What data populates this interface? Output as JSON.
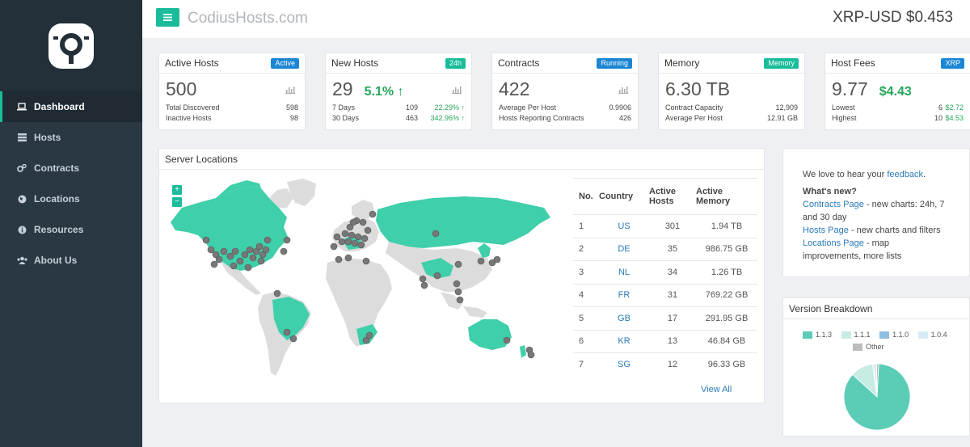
{
  "header": {
    "site_title": "CodiusHosts.com",
    "ticker": "XRP-USD $0.453"
  },
  "sidebar": {
    "items": [
      {
        "label": "Dashboard",
        "icon": "laptop-icon"
      },
      {
        "label": "Hosts",
        "icon": "server-icon"
      },
      {
        "label": "Contracts",
        "icon": "cogs-icon"
      },
      {
        "label": "Locations",
        "icon": "globe-icon"
      },
      {
        "label": "Resources",
        "icon": "info-icon"
      },
      {
        "label": "About Us",
        "icon": "users-icon"
      }
    ]
  },
  "stats": {
    "active": {
      "title": "Active Hosts",
      "badge": "Active",
      "big": "500",
      "r1k": "Total Discovered",
      "r1v": "598",
      "r2k": "Inactive Hosts",
      "r2v": "98"
    },
    "new": {
      "title": "New Hosts",
      "badge": "24h",
      "big": "29",
      "big_extra": "5.1%",
      "r1k": "7 Days",
      "r1v": "109",
      "r1g": "22.29%",
      "r2k": "30 Days",
      "r2v": "463",
      "r2g": "342.96%"
    },
    "contracts": {
      "title": "Contracts",
      "badge": "Running",
      "big": "422",
      "r1k": "Average Per Host",
      "r1v": "0.9906",
      "r2k": "Hosts Reporting Contracts",
      "r2v": "426"
    },
    "memory": {
      "title": "Memory",
      "badge": "Memory",
      "big": "6.30 TB",
      "r1k": "Contract Capacity",
      "r1v": "12,909",
      "r2k": "Average Per Host",
      "r2v": "12.91 GB"
    },
    "fees": {
      "title": "Host Fees",
      "badge": "XRP",
      "big": "9.77",
      "big_extra": "$4.43",
      "r1k": "Lowest",
      "r1v": "6",
      "r1g": "$2.72",
      "r2k": "Highest",
      "r2v": "10",
      "r2g": "$4.53"
    }
  },
  "server_locations": {
    "title": "Server Locations",
    "zoom_in": "+",
    "zoom_out": "−",
    "columns": {
      "no": "No.",
      "country": "Country",
      "hosts": "Active Hosts",
      "memory": "Active Memory"
    },
    "rows": [
      {
        "no": "1",
        "country": "US",
        "hosts": "301",
        "memory": "1.94 TB"
      },
      {
        "no": "2",
        "country": "DE",
        "hosts": "35",
        "memory": "986.75 GB"
      },
      {
        "no": "3",
        "country": "NL",
        "hosts": "34",
        "memory": "1.26 TB"
      },
      {
        "no": "4",
        "country": "FR",
        "hosts": "31",
        "memory": "769.22 GB"
      },
      {
        "no": "5",
        "country": "GB",
        "hosts": "17",
        "memory": "291.95 GB"
      },
      {
        "no": "6",
        "country": "KR",
        "hosts": "13",
        "memory": "46.84 GB"
      },
      {
        "no": "7",
        "country": "SG",
        "hosts": "12",
        "memory": "96.33 GB"
      }
    ],
    "view_all": "View All"
  },
  "feedback": {
    "intro": "We love to hear your",
    "link": "feedback",
    "intro_end": ".",
    "whats_new": "What's new?",
    "items": [
      {
        "link": "Contracts Page",
        "text": " - new charts: 24h, 7 and 30 day"
      },
      {
        "link": "Hosts Page",
        "text": " - new charts and filters"
      },
      {
        "link": "Locations Page",
        "text": " - map improvements, more lists"
      }
    ]
  },
  "version": {
    "title": "Version Breakdown",
    "colors": {
      "v113": "#5bcdb6",
      "v111": "#c6ece3",
      "v110": "#8fc0e2",
      "v104": "#d6ecf5",
      "other": "#bcbcbc"
    },
    "legend": [
      "1.1.3",
      "1.1.1",
      "1.1.0",
      "1.0.4",
      "Other"
    ]
  },
  "chart_data": {
    "type": "pie",
    "title": "Version Breakdown",
    "categories": [
      "1.1.3",
      "1.1.1",
      "1.1.0",
      "1.0.4",
      "Other"
    ],
    "values": [
      86,
      11,
      0.5,
      1.5,
      1
    ]
  },
  "colors": {
    "accent": "#1abc9c",
    "land_active": "#3fcfaa",
    "land": "#dcdcdc",
    "marker": "#777777",
    "link": "#2a7ab8",
    "green": "#26a65b"
  }
}
